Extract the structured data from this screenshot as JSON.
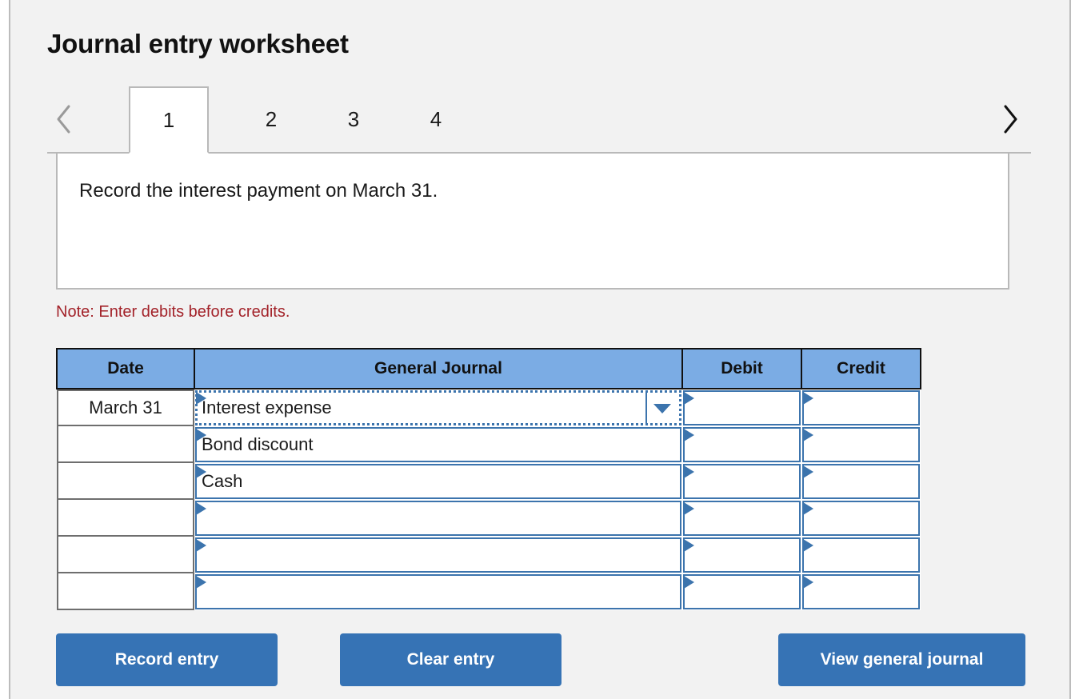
{
  "page": {
    "title": "Journal entry worksheet",
    "background": "#f2f2f2",
    "accent": "#3673b5",
    "header_fill": "#7bace4",
    "note_color": "#a3232a"
  },
  "tabs": {
    "prev_label": "previous",
    "next_label": "next",
    "items": [
      {
        "label": "1",
        "active": true
      },
      {
        "label": "2",
        "active": false
      },
      {
        "label": "3",
        "active": false
      },
      {
        "label": "4",
        "active": false
      }
    ]
  },
  "instruction": {
    "text": "Record the interest payment on March 31."
  },
  "note": {
    "text": "Note: Enter debits before credits."
  },
  "table": {
    "headers": [
      "Date",
      "General Journal",
      "Debit",
      "Credit"
    ],
    "rows": [
      {
        "date": "March 31",
        "account": "Interest expense",
        "debit": "",
        "credit": "",
        "focused": true
      },
      {
        "date": "",
        "account": "Bond discount",
        "debit": "",
        "credit": "",
        "focused": false
      },
      {
        "date": "",
        "account": "Cash",
        "debit": "",
        "credit": "",
        "focused": false
      },
      {
        "date": "",
        "account": "",
        "debit": "",
        "credit": "",
        "focused": false
      },
      {
        "date": "",
        "account": "",
        "debit": "",
        "credit": "",
        "focused": false
      },
      {
        "date": "",
        "account": "",
        "debit": "",
        "credit": "",
        "focused": false
      }
    ]
  },
  "buttons": {
    "record": "Record entry",
    "clear": "Clear entry",
    "view": "View general journal"
  }
}
